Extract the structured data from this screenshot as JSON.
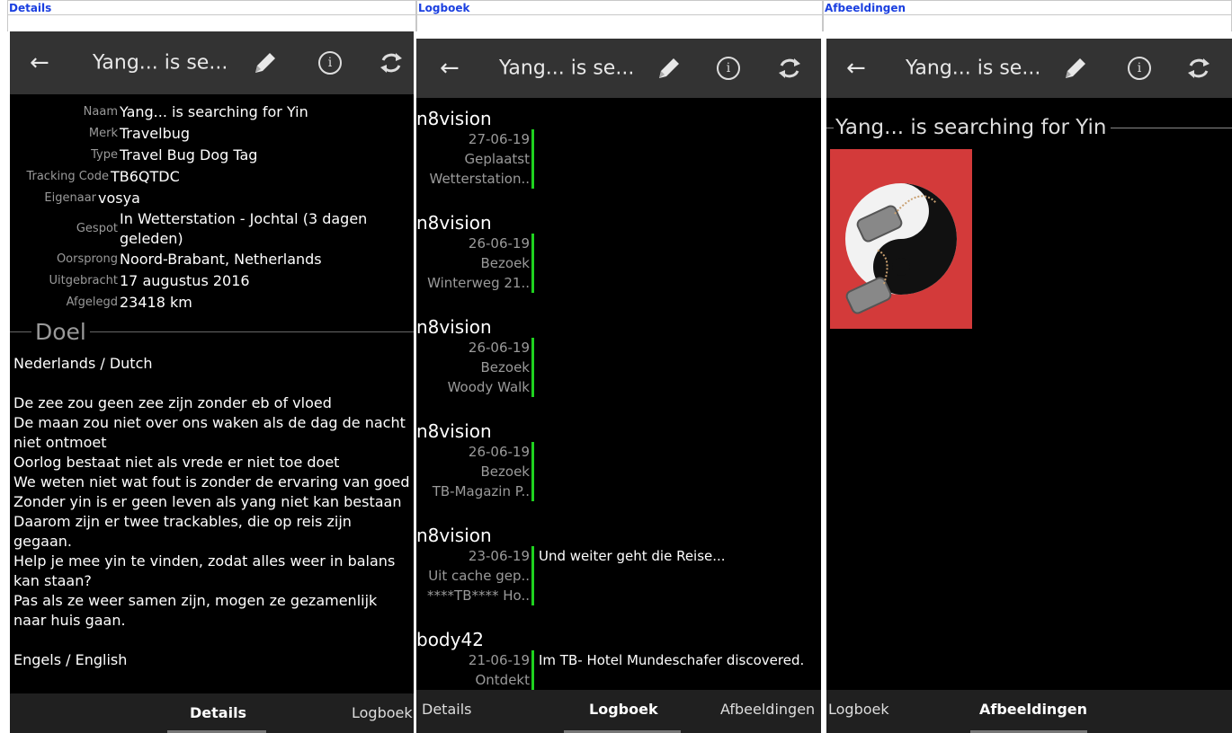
{
  "columns": {
    "details_header": "Details",
    "logboek_header": "Logboek",
    "afbeeldingen_header": "Afbeeldingen"
  },
  "toolbar": {
    "title": "Yang... is se...",
    "back_icon": "arrow-left-icon",
    "edit_icon": "pencil-icon",
    "info_icon": "info-icon",
    "info_glyph": "i",
    "sync_icon": "refresh-icon"
  },
  "details": {
    "fields": [
      {
        "label": "Naam",
        "value": "Yang... is searching for Yin"
      },
      {
        "label": "Merk",
        "value": "Travelbug"
      },
      {
        "label": "Type",
        "value": "Travel Bug Dog Tag"
      },
      {
        "label": "Tracking Code",
        "value": "TB6QTDC"
      },
      {
        "label": "Eigenaar",
        "value": "vosya"
      },
      {
        "label": "Gespot",
        "value": "In Wetterstation - Jochtal (3 dagen geleden)"
      },
      {
        "label": "Oorsprong",
        "value": "Noord-Brabant, Netherlands"
      },
      {
        "label": "Uitgebracht",
        "value": "17 augustus 2016"
      },
      {
        "label": "Afgelegd",
        "value": "23418 km"
      }
    ],
    "goal_title": "Doel",
    "goal_text": "Nederlands / Dutch\n\nDe zee zou geen zee zijn zonder eb of vloed\nDe maan zou niet over ons waken als de dag de nacht niet ontmoet\nOorlog bestaat niet als vrede er niet toe doet\nWe weten niet wat fout is zonder de ervaring van goed\nZonder yin is er geen leven als yang niet kan bestaan\nDaarom zijn er twee trackables, die op reis zijn gegaan.\nHelp je mee yin te vinden, zodat alles weer in balans kan staan?\nPas als ze weer samen zijn, mogen ze gezamenlijk naar huis gaan.\n\nEngels / English\n\n\nThe sea wouldn't exist without low and high tide"
  },
  "logs": [
    {
      "author": "n8vision",
      "date": "27-06-19",
      "type": "Geplaatst",
      "cache": "Wetterstation..",
      "text": ""
    },
    {
      "author": "n8vision",
      "date": "26-06-19",
      "type": "Bezoek",
      "cache": "Winterweg 21..",
      "text": ""
    },
    {
      "author": "n8vision",
      "date": "26-06-19",
      "type": "Bezoek",
      "cache": "Woody Walk",
      "text": ""
    },
    {
      "author": "n8vision",
      "date": "26-06-19",
      "type": "Bezoek",
      "cache": "TB-Magazin P..",
      "text": ""
    },
    {
      "author": "n8vision",
      "date": "23-06-19",
      "type": "Uit cache gep..",
      "cache": "****TB**** Ho..",
      "text": "Und weiter geht die Reise..."
    },
    {
      "author": "body42",
      "date": "21-06-19",
      "type": "Ontdekt",
      "cache": "",
      "text": "Im TB- Hotel Mundeschafer discovered."
    }
  ],
  "images": {
    "title": "Yang... is searching for Yin"
  },
  "nav": {
    "col1": {
      "active": "Details",
      "right": "Logboek"
    },
    "col2": {
      "left": "Details",
      "active": "Logboek",
      "right": "Afbeeldingen"
    },
    "col3": {
      "left": "Logboek",
      "active": "Afbeeldingen"
    }
  },
  "colors": {
    "accent_green": "#1fd11f",
    "toolbar_bg": "#333333",
    "image_bg": "#d33a3a"
  }
}
